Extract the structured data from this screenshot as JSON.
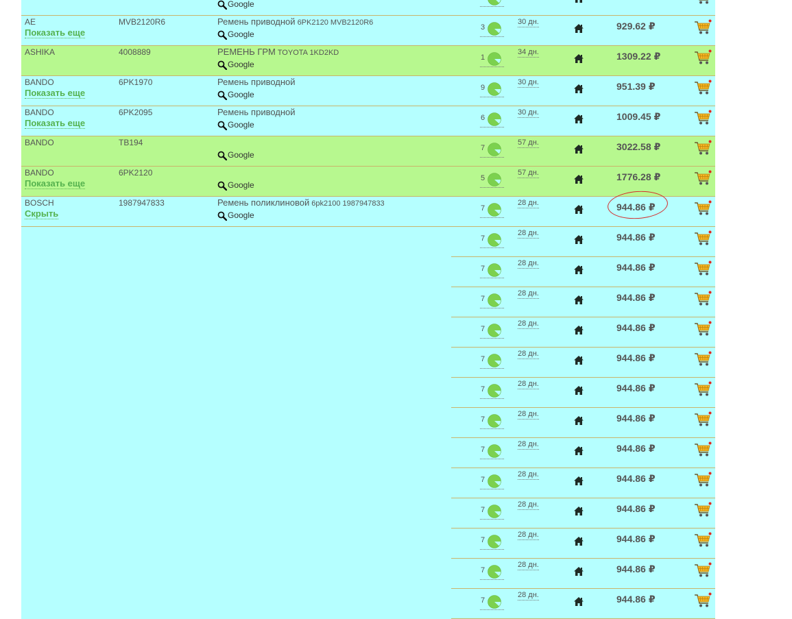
{
  "labels": {
    "show_more": "Показать еще",
    "hide": "Скрыть",
    "google": "Google",
    "currency": "₽"
  },
  "icons": {
    "availability": "pie-chart-icon",
    "warehouse": "home-icon",
    "cart": "shopping-cart-icon",
    "search": "magnifier-icon"
  },
  "colors": {
    "row_cyan": "#b5ffff",
    "row_green": "#b7f88f",
    "link_green": "#55b24e",
    "highlight_red": "#d42a2a"
  },
  "rows": [
    {
      "type": "main",
      "bg": "cyan",
      "brand": "",
      "link": "show_more",
      "article": "",
      "desc": "",
      "desc_small": "",
      "qty": "",
      "days": "",
      "price": ""
    },
    {
      "type": "main",
      "bg": "cyan",
      "brand": "AE",
      "link": "show_more",
      "article": "MVB2120R6",
      "desc": "Ремень приводной",
      "desc_small": "6PK2120 MVB2120R6",
      "qty": "3",
      "days": "30 дн.",
      "price": "929.62"
    },
    {
      "type": "main",
      "bg": "green",
      "brand": "ASHIKA",
      "link": "",
      "article": "4008889",
      "desc": "РЕМЕНЬ ГРМ",
      "desc_small": "TOYOTA 1KD2KD",
      "qty": "1",
      "days": "34 дн.",
      "price": "1309.22"
    },
    {
      "type": "main",
      "bg": "cyan",
      "brand": "BANDO",
      "link": "show_more",
      "article": "6PK1970",
      "desc": "Ремень приводной",
      "desc_small": "",
      "qty": "9",
      "days": "30 дн.",
      "price": "951.39"
    },
    {
      "type": "main",
      "bg": "cyan",
      "brand": "BANDO",
      "link": "show_more",
      "article": "6PK2095",
      "desc": "Ремень приводной",
      "desc_small": "",
      "qty": "6",
      "days": "30 дн.",
      "price": "1009.45"
    },
    {
      "type": "main",
      "bg": "green",
      "brand": "BANDO",
      "link": "",
      "article": "TB194",
      "desc": "",
      "desc_small": "",
      "qty": "7",
      "days": "57 дн.",
      "price": "3022.58"
    },
    {
      "type": "main",
      "bg": "green",
      "brand": "BANDO",
      "link": "show_more",
      "article": "6PK2120",
      "desc": "",
      "desc_small": "",
      "qty": "5",
      "days": "57 дн.",
      "price": "1776.28"
    },
    {
      "type": "main",
      "bg": "cyan",
      "brand": "BOSCH",
      "link": "hide",
      "article": "1987947833",
      "desc": "Ремень поликлиновой",
      "desc_small": "6pk2100 1987947833",
      "qty": "7",
      "days": "28 дн.",
      "price": "944.86",
      "highlighted": "true"
    },
    {
      "type": "sub",
      "qty": "7",
      "days": "28 дн.",
      "price": "944.86"
    },
    {
      "type": "sub",
      "qty": "7",
      "days": "28 дн.",
      "price": "944.86"
    },
    {
      "type": "sub",
      "qty": "7",
      "days": "28 дн.",
      "price": "944.86"
    },
    {
      "type": "sub",
      "qty": "7",
      "days": "28 дн.",
      "price": "944.86"
    },
    {
      "type": "sub",
      "qty": "7",
      "days": "28 дн.",
      "price": "944.86"
    },
    {
      "type": "sub",
      "qty": "7",
      "days": "28 дн.",
      "price": "944.86"
    },
    {
      "type": "sub",
      "qty": "7",
      "days": "28 дн.",
      "price": "944.86"
    },
    {
      "type": "sub",
      "qty": "7",
      "days": "28 дн.",
      "price": "944.86"
    },
    {
      "type": "sub",
      "qty": "7",
      "days": "28 дн.",
      "price": "944.86"
    },
    {
      "type": "sub",
      "qty": "7",
      "days": "28 дн.",
      "price": "944.86"
    },
    {
      "type": "sub",
      "qty": "7",
      "days": "28 дн.",
      "price": "944.86"
    },
    {
      "type": "sub",
      "qty": "7",
      "days": "28 дн.",
      "price": "944.86"
    },
    {
      "type": "sub",
      "qty": "7",
      "days": "28 дн.",
      "price": "944.86"
    }
  ]
}
